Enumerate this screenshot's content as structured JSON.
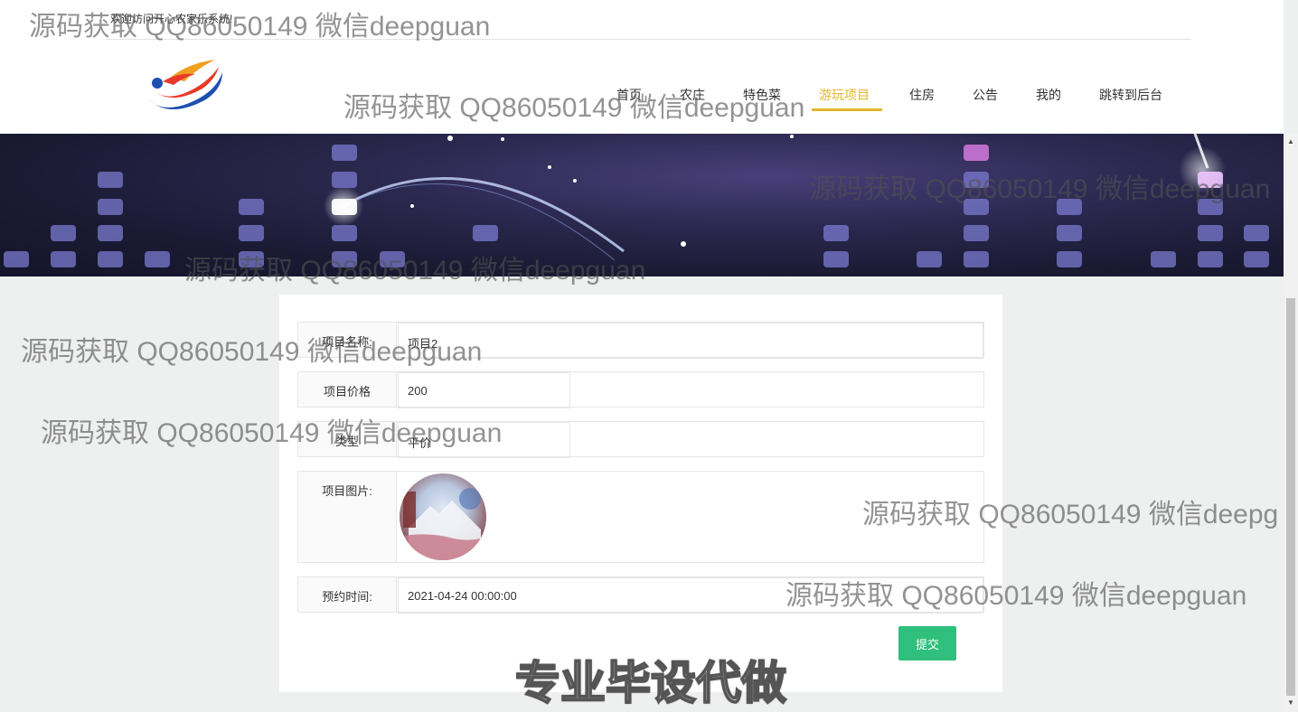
{
  "topbar": {
    "welcome": "欢迎访问开心农家乐系统!"
  },
  "nav": [
    {
      "label": "首页",
      "active": false
    },
    {
      "label": "农庄",
      "active": false
    },
    {
      "label": "特色菜",
      "active": false
    },
    {
      "label": "游玩项目",
      "active": true
    },
    {
      "label": "住房",
      "active": false
    },
    {
      "label": "公告",
      "active": false
    },
    {
      "label": "我的",
      "active": false
    },
    {
      "label": "跳转到后台",
      "active": false
    }
  ],
  "form": {
    "name_label": "项目名称:",
    "name_value": "项目2",
    "price_label": "项目价格",
    "price_value": "200",
    "type_label": "类型",
    "type_value": "平价",
    "image_label": "项目图片:",
    "time_label": "预约时间:",
    "time_value": "2021-04-24 00:00:00",
    "submit": "提交"
  },
  "watermark": {
    "text": "源码获取 QQ86050149 微信deepguan",
    "text_cut": "源码获取 QQ86050149 微信deepg",
    "big": "专业毕设代做"
  },
  "colors": {
    "accent": "#e5b52b",
    "submit": "#2ec07c"
  }
}
